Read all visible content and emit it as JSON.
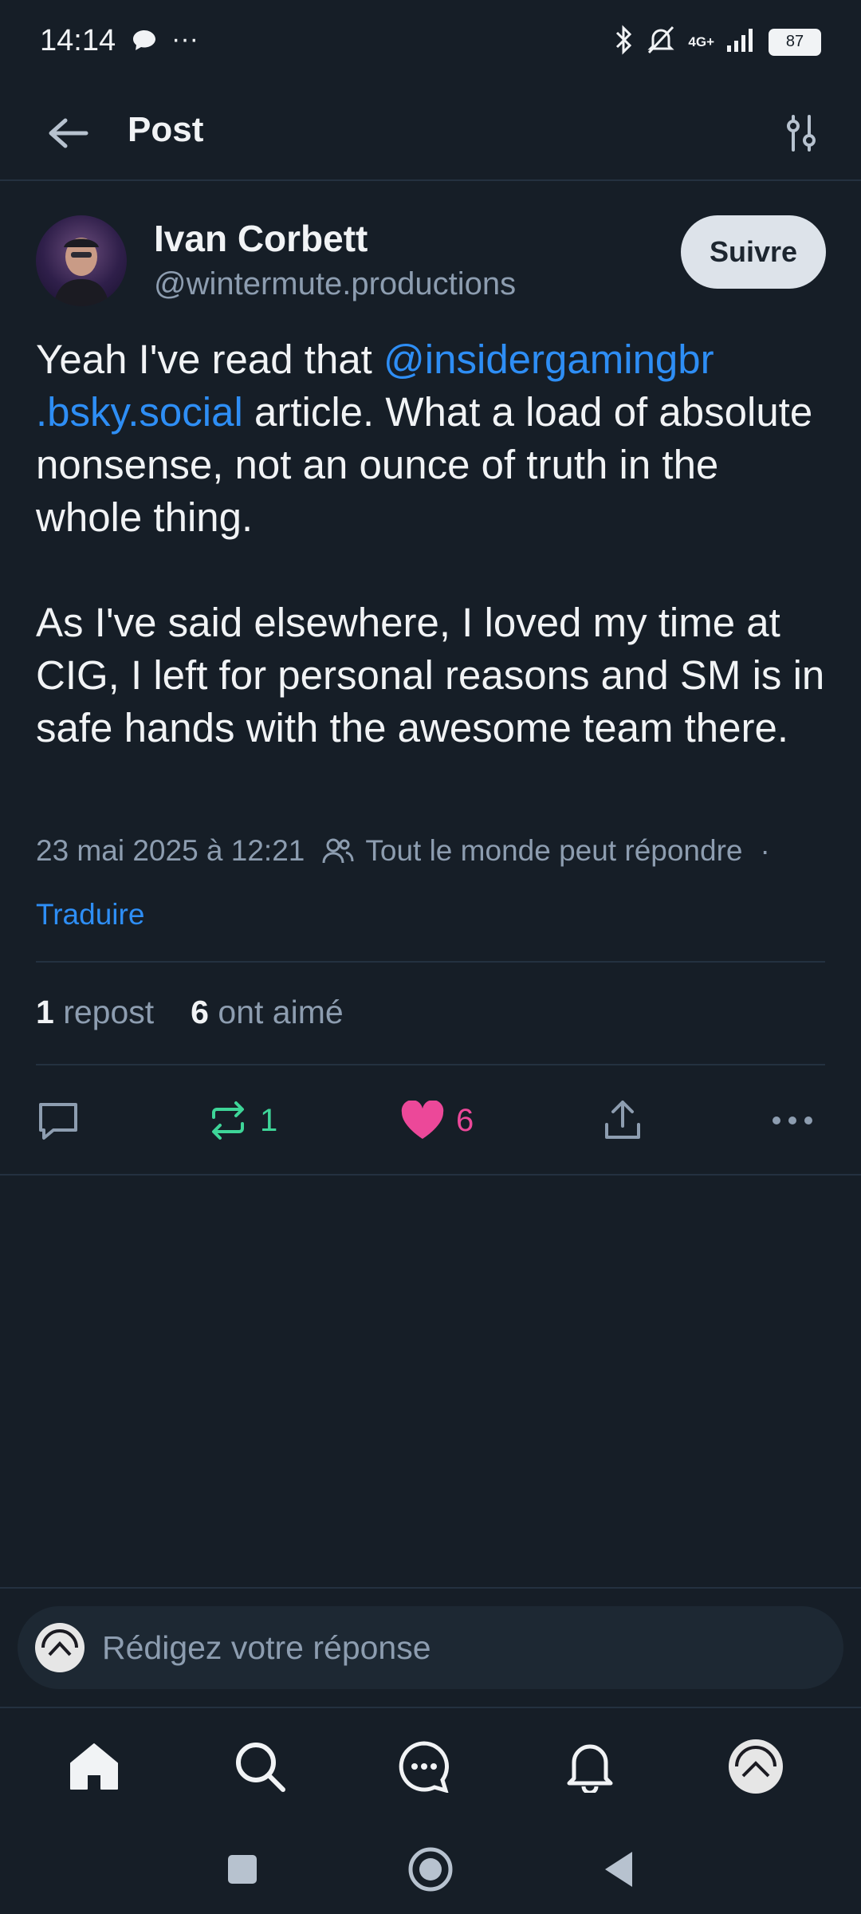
{
  "status_bar": {
    "time": "14:14",
    "network": "4G+",
    "battery": "87"
  },
  "header": {
    "title": "Post"
  },
  "post": {
    "author_name": "Ivan Corbett",
    "author_handle": "@wintermute.productions",
    "follow_label": "Suivre",
    "text_p1_before": "Yeah I've read that ",
    "mention_part1": "@insidergamingbr",
    "mention_part2": ".bsky.social",
    "text_p1_after": "  article. What a load of absolute nonsense, not an ounce of truth in the whole thing.",
    "text_p2": "As I've said elsewhere, I loved my time at CIG, I left for personal reasons and SM is in safe hands with the awesome team there.",
    "timestamp": "23 mai 2025 à 12:21",
    "reply_setting": "Tout le monde peut répondre",
    "separator": "·",
    "translate_label": "Traduire",
    "reposts_count": "1",
    "reposts_label": "repost",
    "likes_count": "6",
    "likes_label": "ont aimé",
    "action_repost_count": "1",
    "action_like_count": "6"
  },
  "reply": {
    "placeholder": "Rédigez votre réponse"
  },
  "colors": {
    "accent": "#2e8ef5",
    "repost": "#3ed598",
    "like": "#ec4899",
    "background": "#161e27"
  },
  "icons": {
    "nav": [
      "home-icon",
      "search-icon",
      "messages-icon",
      "notifications-icon",
      "profile-avatar"
    ],
    "system": [
      "recents-icon",
      "home-circle-icon",
      "back-triangle-icon"
    ]
  }
}
